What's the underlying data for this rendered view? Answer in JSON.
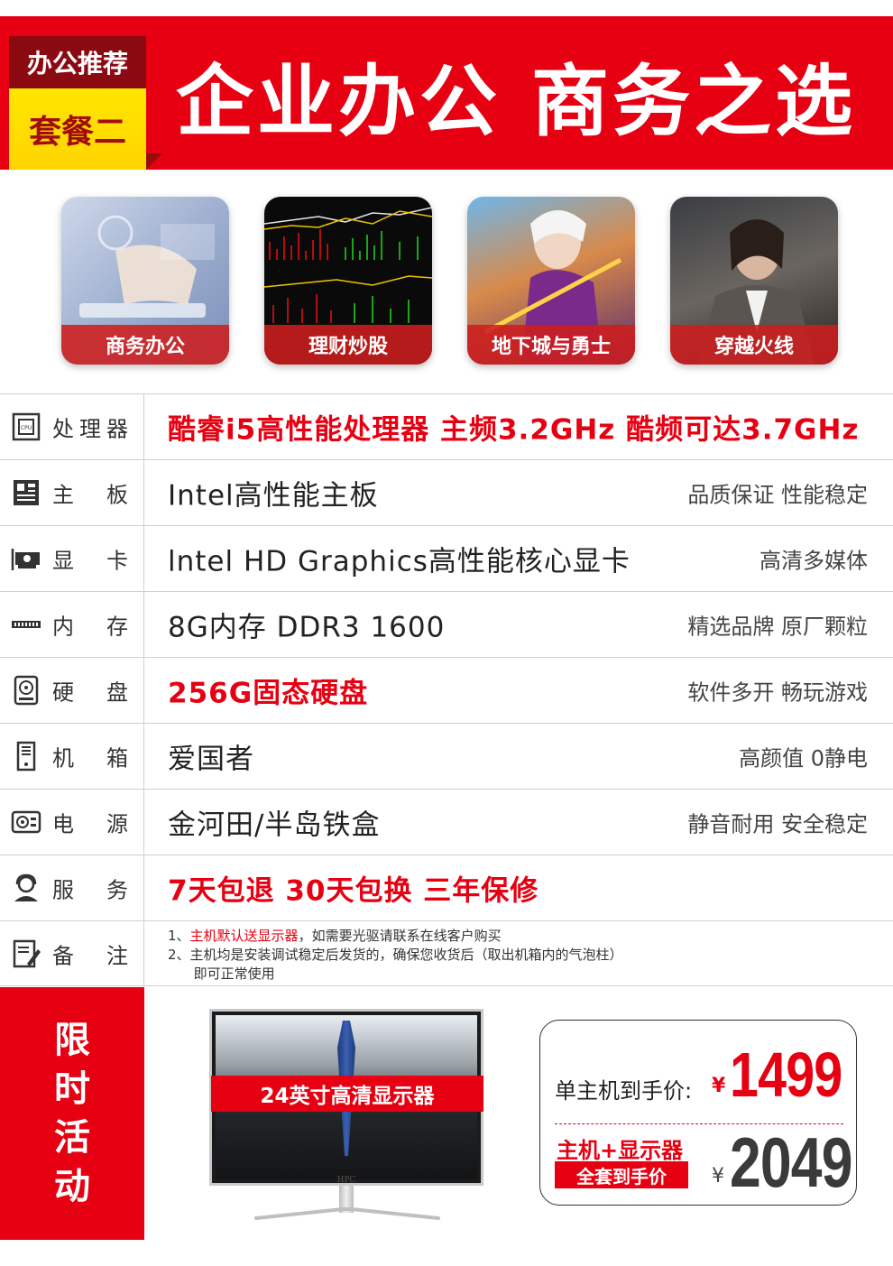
{
  "header": {
    "badge_top": "办公推荐",
    "badge_bottom": "套餐二",
    "title": "企业办公  商务之选"
  },
  "apps": [
    {
      "label": "商务办公",
      "icon": "office-work-image"
    },
    {
      "label": "理财炒股",
      "icon": "stock-chart-image"
    },
    {
      "label": "地下城与勇士",
      "icon": "dnf-game-image"
    },
    {
      "label": "穿越火线",
      "icon": "crossfire-game-image"
    }
  ],
  "specs": [
    {
      "label": [
        "处",
        "理",
        "器"
      ],
      "icon": "cpu-icon",
      "value": "酷睿i5高性能处理器  主频3.2GHz  酷频可达3.7GHz",
      "note": "",
      "highlight": true
    },
    {
      "label": [
        "主",
        "板"
      ],
      "icon": "motherboard-icon",
      "value": "Intel高性能主板",
      "note": "品质保证  性能稳定",
      "highlight": false
    },
    {
      "label": [
        "显",
        "卡"
      ],
      "icon": "graphics-card-icon",
      "value": "lntel HD Graphics高性能核心显卡",
      "note": "高清多媒体",
      "highlight": false
    },
    {
      "label": [
        "内",
        "存"
      ],
      "icon": "memory-icon",
      "value": "8G内存   DDR3   1600",
      "note": "精选品牌  原厂颗粒",
      "highlight": false
    },
    {
      "label": [
        "硬",
        "盘"
      ],
      "icon": "hard-disk-icon",
      "value": "256G固态硬盘",
      "note": "软件多开  畅玩游戏",
      "highlight": true
    },
    {
      "label": [
        "机",
        "箱"
      ],
      "icon": "pc-case-icon",
      "value": "爱国者",
      "note": "高颜值  0静电",
      "highlight": false
    },
    {
      "label": [
        "电",
        "源"
      ],
      "icon": "power-supply-icon",
      "value": "金河田/半岛铁盒",
      "note": "静音耐用  安全稳定",
      "highlight": false
    },
    {
      "label": [
        "服",
        "务"
      ],
      "icon": "customer-service-icon",
      "value": "7天包退   30天包换   三年保修",
      "note": "",
      "highlight": true
    }
  ],
  "remark": {
    "label": [
      "备",
      "注"
    ],
    "icon": "note-edit-icon",
    "line1_prefix": "1、",
    "line1_highlight": "主机默认送显示器",
    "line1_rest": "，如需要光驱请联系在线客户购买",
    "line2": "2、主机均是安装调试稳定后发货的，确保您收货后（取出机箱内的气泡柱）",
    "line3": "      即可正常使用"
  },
  "promo": {
    "side_chars": [
      "限",
      "时",
      "活",
      "动"
    ],
    "monitor_label": "24英寸高清显示器",
    "monitor_brand": "HPC",
    "price1_label": "单主机到手价:",
    "price1_currency": "¥",
    "price1_value": "1499",
    "price2_label": "主机+显示器",
    "price2_sub": "全套到手价",
    "price2_currency": "¥",
    "price2_value": "2049"
  },
  "colors": {
    "accent": "#e60012",
    "badge_dark": "#8b0a12",
    "badge_yellow": "#ffe600"
  }
}
